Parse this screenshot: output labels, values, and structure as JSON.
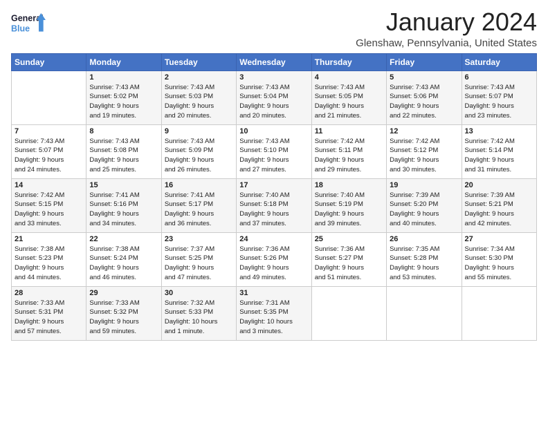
{
  "logo": {
    "line1": "General",
    "line2": "Blue"
  },
  "title": "January 2024",
  "location": "Glenshaw, Pennsylvania, United States",
  "headers": [
    "Sunday",
    "Monday",
    "Tuesday",
    "Wednesday",
    "Thursday",
    "Friday",
    "Saturday"
  ],
  "weeks": [
    [
      {
        "day": "",
        "content": ""
      },
      {
        "day": "1",
        "content": "Sunrise: 7:43 AM\nSunset: 5:02 PM\nDaylight: 9 hours\nand 19 minutes."
      },
      {
        "day": "2",
        "content": "Sunrise: 7:43 AM\nSunset: 5:03 PM\nDaylight: 9 hours\nand 20 minutes."
      },
      {
        "day": "3",
        "content": "Sunrise: 7:43 AM\nSunset: 5:04 PM\nDaylight: 9 hours\nand 20 minutes."
      },
      {
        "day": "4",
        "content": "Sunrise: 7:43 AM\nSunset: 5:05 PM\nDaylight: 9 hours\nand 21 minutes."
      },
      {
        "day": "5",
        "content": "Sunrise: 7:43 AM\nSunset: 5:06 PM\nDaylight: 9 hours\nand 22 minutes."
      },
      {
        "day": "6",
        "content": "Sunrise: 7:43 AM\nSunset: 5:07 PM\nDaylight: 9 hours\nand 23 minutes."
      }
    ],
    [
      {
        "day": "7",
        "content": "Sunrise: 7:43 AM\nSunset: 5:07 PM\nDaylight: 9 hours\nand 24 minutes."
      },
      {
        "day": "8",
        "content": "Sunrise: 7:43 AM\nSunset: 5:08 PM\nDaylight: 9 hours\nand 25 minutes."
      },
      {
        "day": "9",
        "content": "Sunrise: 7:43 AM\nSunset: 5:09 PM\nDaylight: 9 hours\nand 26 minutes."
      },
      {
        "day": "10",
        "content": "Sunrise: 7:43 AM\nSunset: 5:10 PM\nDaylight: 9 hours\nand 27 minutes."
      },
      {
        "day": "11",
        "content": "Sunrise: 7:42 AM\nSunset: 5:11 PM\nDaylight: 9 hours\nand 29 minutes."
      },
      {
        "day": "12",
        "content": "Sunrise: 7:42 AM\nSunset: 5:12 PM\nDaylight: 9 hours\nand 30 minutes."
      },
      {
        "day": "13",
        "content": "Sunrise: 7:42 AM\nSunset: 5:14 PM\nDaylight: 9 hours\nand 31 minutes."
      }
    ],
    [
      {
        "day": "14",
        "content": "Sunrise: 7:42 AM\nSunset: 5:15 PM\nDaylight: 9 hours\nand 33 minutes."
      },
      {
        "day": "15",
        "content": "Sunrise: 7:41 AM\nSunset: 5:16 PM\nDaylight: 9 hours\nand 34 minutes."
      },
      {
        "day": "16",
        "content": "Sunrise: 7:41 AM\nSunset: 5:17 PM\nDaylight: 9 hours\nand 36 minutes."
      },
      {
        "day": "17",
        "content": "Sunrise: 7:40 AM\nSunset: 5:18 PM\nDaylight: 9 hours\nand 37 minutes."
      },
      {
        "day": "18",
        "content": "Sunrise: 7:40 AM\nSunset: 5:19 PM\nDaylight: 9 hours\nand 39 minutes."
      },
      {
        "day": "19",
        "content": "Sunrise: 7:39 AM\nSunset: 5:20 PM\nDaylight: 9 hours\nand 40 minutes."
      },
      {
        "day": "20",
        "content": "Sunrise: 7:39 AM\nSunset: 5:21 PM\nDaylight: 9 hours\nand 42 minutes."
      }
    ],
    [
      {
        "day": "21",
        "content": "Sunrise: 7:38 AM\nSunset: 5:23 PM\nDaylight: 9 hours\nand 44 minutes."
      },
      {
        "day": "22",
        "content": "Sunrise: 7:38 AM\nSunset: 5:24 PM\nDaylight: 9 hours\nand 46 minutes."
      },
      {
        "day": "23",
        "content": "Sunrise: 7:37 AM\nSunset: 5:25 PM\nDaylight: 9 hours\nand 47 minutes."
      },
      {
        "day": "24",
        "content": "Sunrise: 7:36 AM\nSunset: 5:26 PM\nDaylight: 9 hours\nand 49 minutes."
      },
      {
        "day": "25",
        "content": "Sunrise: 7:36 AM\nSunset: 5:27 PM\nDaylight: 9 hours\nand 51 minutes."
      },
      {
        "day": "26",
        "content": "Sunrise: 7:35 AM\nSunset: 5:28 PM\nDaylight: 9 hours\nand 53 minutes."
      },
      {
        "day": "27",
        "content": "Sunrise: 7:34 AM\nSunset: 5:30 PM\nDaylight: 9 hours\nand 55 minutes."
      }
    ],
    [
      {
        "day": "28",
        "content": "Sunrise: 7:33 AM\nSunset: 5:31 PM\nDaylight: 9 hours\nand 57 minutes."
      },
      {
        "day": "29",
        "content": "Sunrise: 7:33 AM\nSunset: 5:32 PM\nDaylight: 9 hours\nand 59 minutes."
      },
      {
        "day": "30",
        "content": "Sunrise: 7:32 AM\nSunset: 5:33 PM\nDaylight: 10 hours\nand 1 minute."
      },
      {
        "day": "31",
        "content": "Sunrise: 7:31 AM\nSunset: 5:35 PM\nDaylight: 10 hours\nand 3 minutes."
      },
      {
        "day": "",
        "content": ""
      },
      {
        "day": "",
        "content": ""
      },
      {
        "day": "",
        "content": ""
      }
    ]
  ]
}
